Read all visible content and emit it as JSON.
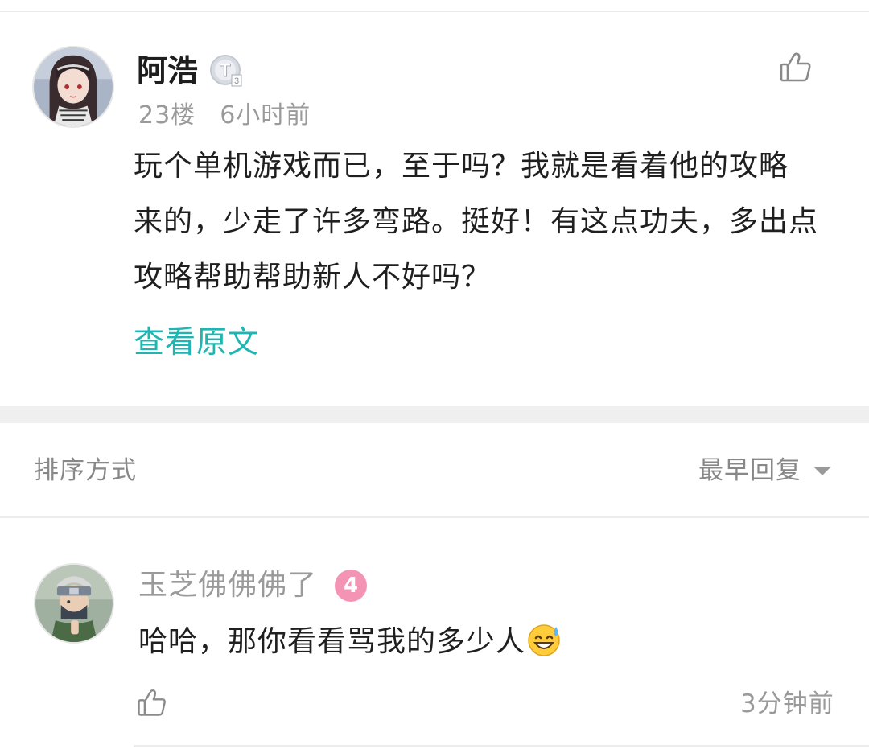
{
  "post": {
    "username": "阿浩",
    "badge_icon": "title-badge-icon",
    "floor": "23楼",
    "time": "6小时前",
    "content_lines": [
      "玩个单机游戏而已，至于吗？我就是看着他的攻略",
      "来的，少走了许多弯路。挺好！有这点功夫，多出点",
      "攻略帮助帮助新人不好吗？"
    ],
    "view_original": "查看原文",
    "like_icon": "thumbs-up-icon"
  },
  "sort": {
    "label": "排序方式",
    "value": "最早回复",
    "caret_icon": "caret-down-icon"
  },
  "reply": {
    "username": "玉芝佛佛佛了",
    "level": "4",
    "text": "哈哈，那你看看骂我的多少人",
    "emoji_icon": "sweat-smile-emoji-icon",
    "time": "3分钟前",
    "like_icon": "thumbs-up-icon"
  },
  "colors": {
    "accent_teal": "#1fb5b2",
    "level_pink": "#f494b4",
    "meta_gray": "#9a9a9a",
    "gap_gray": "#efefef"
  }
}
